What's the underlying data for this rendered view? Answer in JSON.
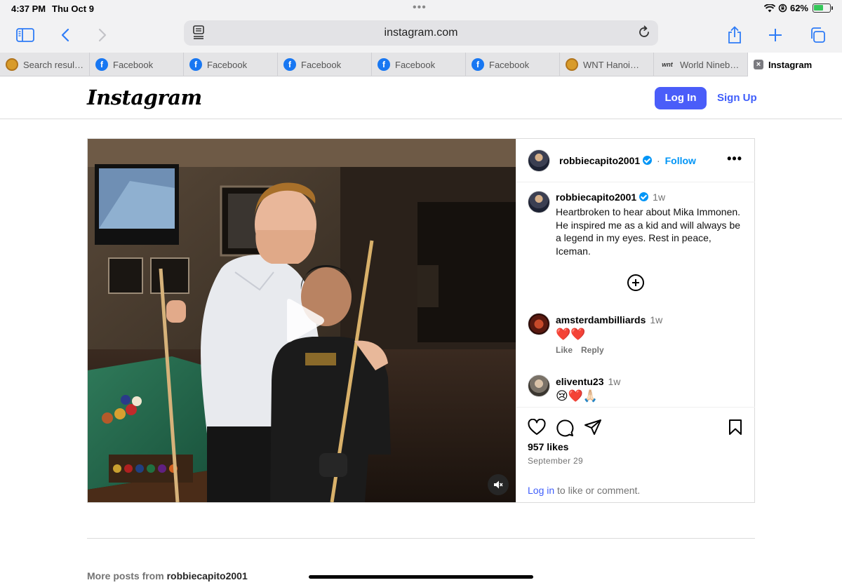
{
  "status_bar": {
    "time": "4:37 PM",
    "date": "Thu Oct 9",
    "battery": "62%",
    "battery_level": 0.62,
    "charging": true
  },
  "toolbar": {
    "url": "instagram.com",
    "icons": [
      "sidebar-icon",
      "back-icon",
      "forward-icon",
      "reader-icon",
      "reload-icon",
      "share-icon",
      "new-tab-icon",
      "tabs-icon"
    ]
  },
  "tabs": [
    {
      "label": "Search resul…",
      "icon": "pool-ball-icon"
    },
    {
      "label": "Facebook",
      "icon": "facebook-icon"
    },
    {
      "label": "Facebook",
      "icon": "facebook-icon"
    },
    {
      "label": "Facebook",
      "icon": "facebook-icon"
    },
    {
      "label": "Facebook",
      "icon": "facebook-icon"
    },
    {
      "label": "Facebook",
      "icon": "facebook-icon"
    },
    {
      "label": "WNT Hanoi…",
      "icon": "pool-ball-icon"
    },
    {
      "label": "World Nineb…",
      "icon": "wnt-icon",
      "icon_text": "wnt"
    },
    {
      "label": "Instagram",
      "icon": "close-icon",
      "active": true
    }
  ],
  "header": {
    "logo": "Instagram",
    "login_label": "Log In",
    "signup_label": "Sign Up"
  },
  "post": {
    "username": "robbiecapito2001",
    "follow_label": "Follow",
    "separator": "·",
    "caption_time": "1w",
    "caption": "Heartbroken to hear about Mika Immonen. He inspired me as a kid and will always be a legend in my eyes. Rest in peace, Iceman.",
    "comments": [
      {
        "username": "amsterdambilliards",
        "time": "1w",
        "text": "❤️❤️",
        "like_label": "Like",
        "reply_label": "Reply"
      },
      {
        "username": "eliventu23",
        "time": "1w",
        "text": "😢❤️🙏🏻"
      }
    ],
    "likes": "957 likes",
    "date": "September 29",
    "login_link": "Log in",
    "login_suffix": " to like or comment."
  },
  "footer": {
    "more_prefix": "More posts from ",
    "more_user": "robbiecapito2001"
  },
  "colors": {
    "accent": "#4a5df9",
    "link": "#3f5efb",
    "verified": "#0095f6",
    "safari_blue": "#2f7cf6"
  }
}
